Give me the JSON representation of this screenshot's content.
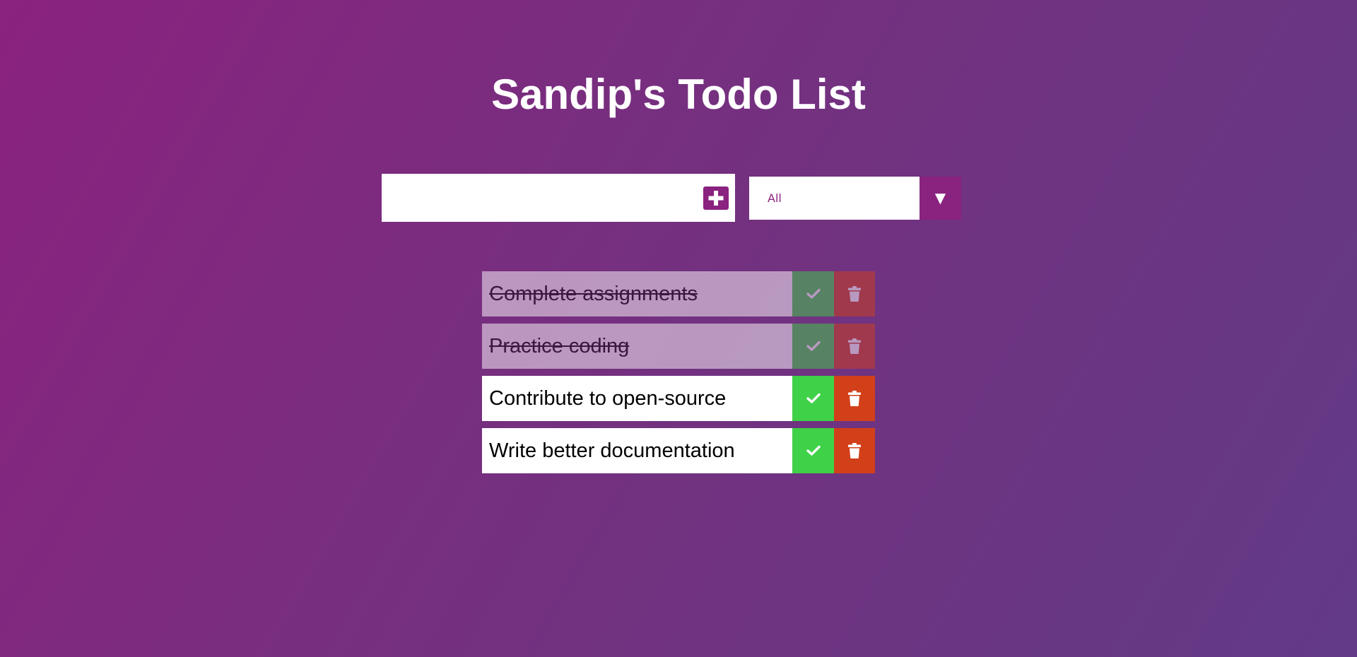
{
  "app": {
    "title": "Sandip's Todo List"
  },
  "input": {
    "value": "",
    "placeholder": ""
  },
  "add_button": {
    "icon": "plus-square-icon"
  },
  "filter": {
    "selected": "All",
    "arrow_icon": "caret-down-icon"
  },
  "todos": [
    {
      "text": "Complete assignments",
      "completed": true
    },
    {
      "text": "Practice coding",
      "completed": true
    },
    {
      "text": "Contribute to open-source",
      "completed": false
    },
    {
      "text": "Write better documentation",
      "completed": false
    }
  ],
  "colors": {
    "accent": "#8a227f",
    "check": "#3fd147",
    "trash": "#d2401a",
    "background_start": "#8a227f",
    "background_end": "#623a86"
  }
}
